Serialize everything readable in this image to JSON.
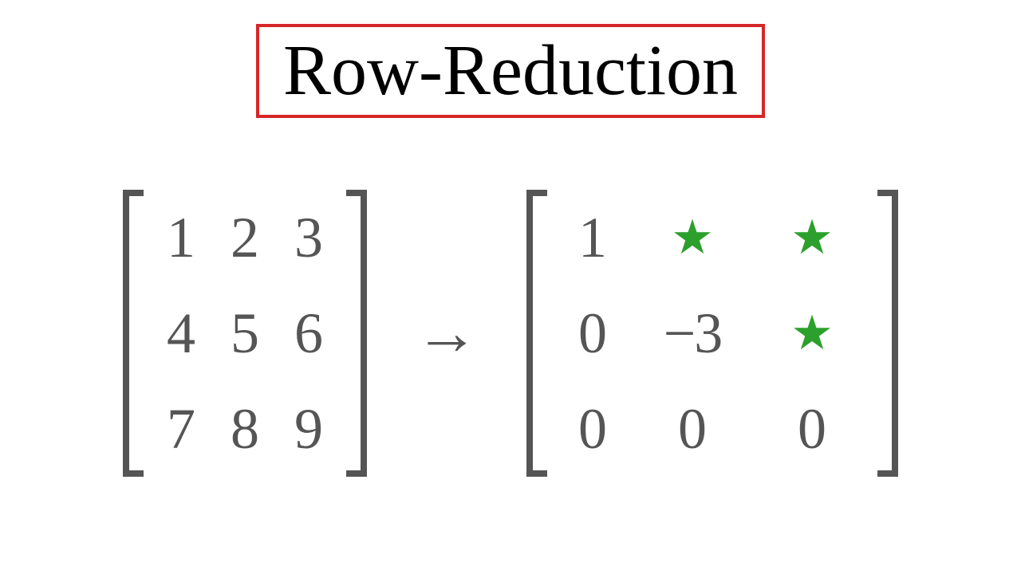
{
  "title": "Row-Reduction",
  "arrow": "→",
  "starGlyph": "★",
  "matrixA": {
    "rows": [
      [
        "1",
        "2",
        "3"
      ],
      [
        "4",
        "5",
        "6"
      ],
      [
        "7",
        "8",
        "9"
      ]
    ]
  },
  "matrixB": {
    "rows": [
      [
        {
          "text": "1"
        },
        {
          "star": true
        },
        {
          "star": true
        }
      ],
      [
        {
          "text": "0"
        },
        {
          "text": "−3",
          "neg": true
        },
        {
          "star": true
        }
      ],
      [
        {
          "text": "0"
        },
        {
          "text": "0"
        },
        {
          "text": "0"
        }
      ]
    ]
  }
}
